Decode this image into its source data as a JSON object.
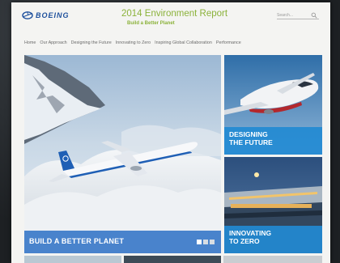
{
  "brand": {
    "logo_text": "BOEING",
    "logo_color": "#1d4f9c"
  },
  "header": {
    "title": "2014 Environment Report",
    "subtitle": "Build a Better Planet",
    "title_color": "#8bb23a"
  },
  "search": {
    "placeholder": "Search..."
  },
  "nav": {
    "items": [
      "Home",
      "Our Approach",
      "Designing the Future",
      "Innovating to Zero",
      "Inspiring Global Collaboration",
      "Performance"
    ]
  },
  "hero": {
    "caption": "BUILD A BETTER PLANET",
    "caption_color": "#2c70c4",
    "slides": 3,
    "active_slide": 1
  },
  "tiles": [
    {
      "caption": "DESIGNING\nTHE FUTURE"
    },
    {
      "caption": "INNOVATING\nTO ZERO"
    }
  ],
  "accent_colors": {
    "tile_blue": "#228ad2",
    "background": "#f4f4f2"
  }
}
